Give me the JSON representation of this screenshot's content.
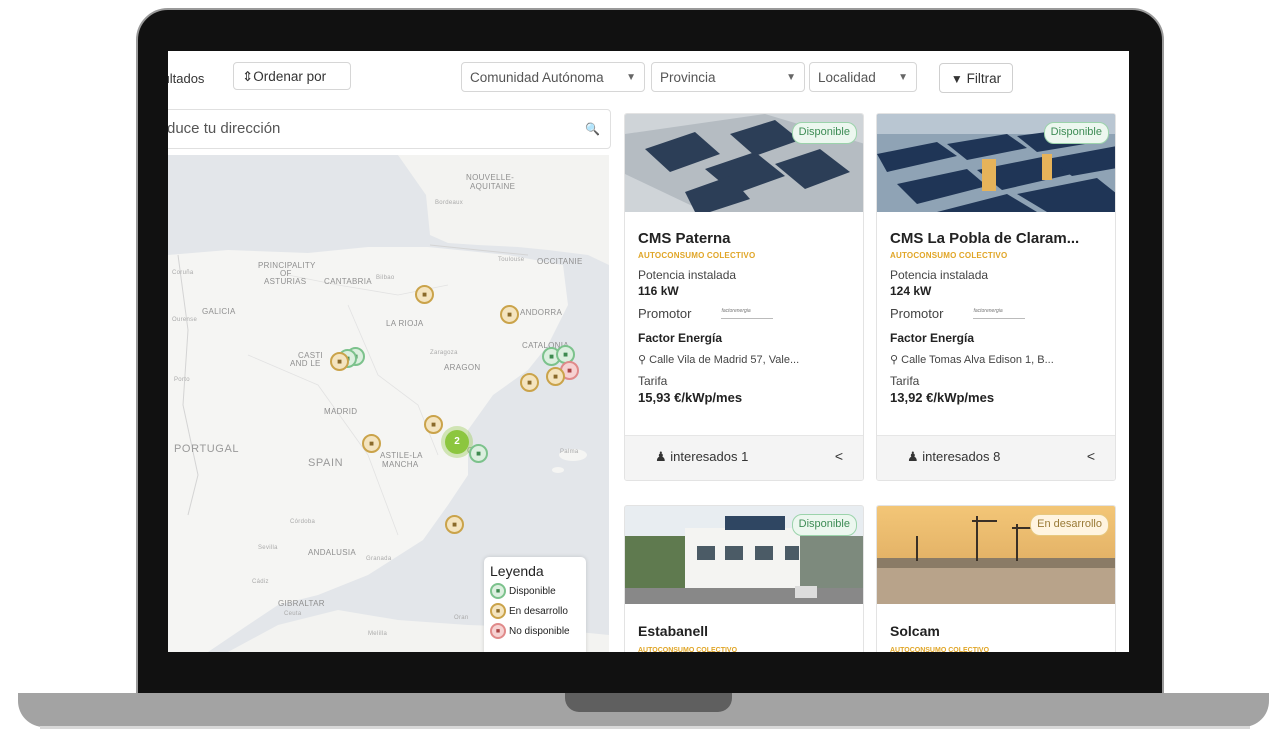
{
  "toolbar": {
    "results_label": "sultados",
    "sort_label": "⇕Ordenar por",
    "community_select": "Comunidad Autónoma",
    "province_select": "Provincia",
    "locality_select": "Localidad",
    "filter_label": "Filtrar"
  },
  "search": {
    "placeholder": "duce tu dirección"
  },
  "map": {
    "country_labels": [
      "PORTUGAL",
      "SPAIN"
    ],
    "region_labels": [
      "PRINCIPALITY",
      "OF",
      "ASTURIAS",
      "CANTABRIA",
      "GALICIA",
      "LA RIOJA",
      "CASTI",
      "AND LE",
      "ARAGON",
      "CATALONIA",
      "MADRID",
      "ASTILE-LA",
      "MANCHA",
      "CO",
      "ANDALUSIA",
      "NOUVELLE-",
      "AQUITAINE",
      "OCCITANIE",
      "ANDORRA",
      "GIBRALTAR"
    ],
    "city_labels": [
      "Bordeaux",
      "Toulouse",
      "Coruña",
      "Ourense",
      "Bilbao",
      "Zaragoza",
      "Porto",
      "Córdoba",
      "Sevilla",
      "Granada",
      "Cádiz",
      "Ceuta",
      "Melilla",
      "Oran",
      "Palma"
    ],
    "cluster_count": "2",
    "legend": {
      "title": "Leyenda",
      "items": [
        "Disponible",
        "En desarrollo",
        "No disponible"
      ]
    }
  },
  "cards": [
    {
      "status": "Disponible",
      "title": "CMS Paterna",
      "type": "AUTOCONSUMO COLECTIVO",
      "power_label": "Potencia instalada",
      "power": "116 kW",
      "promoter_label": "Promotor",
      "promoter_logo": "factorenergia",
      "promoter_name": "Factor Energía",
      "address": "Calle Vila de Madrid 57, Vale...",
      "tariff_label": "Tarifa",
      "tariff": "15,93 €/kWp/mes",
      "interested": "interesados 1"
    },
    {
      "status": "Disponible",
      "title": "CMS La Pobla de Claram...",
      "type": "AUTOCONSUMO COLECTIVO",
      "power_label": "Potencia instalada",
      "power": "124 kW",
      "promoter_label": "Promotor",
      "promoter_logo": "factorenergia",
      "promoter_name": "Factor Energía",
      "address": "Calle Tomas Alva Edison 1, B...",
      "tariff_label": "Tarifa",
      "tariff": "13,92 €/kWp/mes",
      "interested": "interesados 8"
    },
    {
      "status": "Disponible",
      "title": "Estabanell",
      "type": "AUTOCONSUMO COLECTIVO"
    },
    {
      "status": "En desarrollo",
      "title": "Solcam",
      "type": "AUTOCONSUMO COLECTIVO"
    }
  ],
  "colors": {
    "available": "#3d8c55",
    "in_development": "#e0a526",
    "unavailable": "#e08a8a",
    "cluster": "#8cc63f"
  }
}
